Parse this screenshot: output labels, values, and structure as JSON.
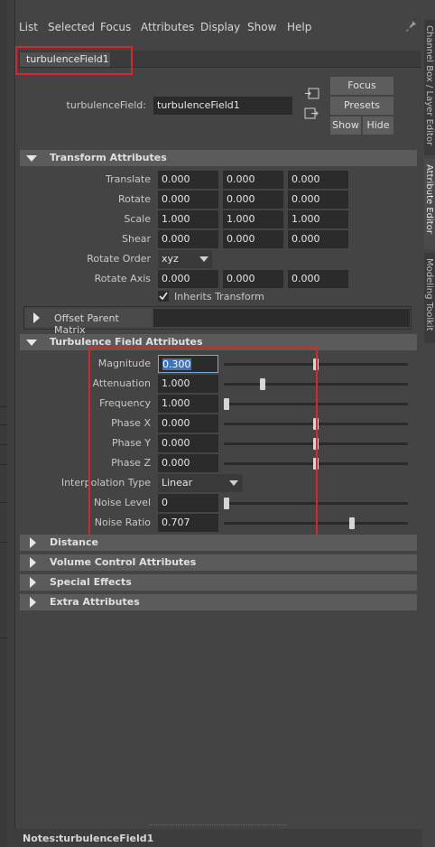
{
  "menubar": {
    "items": [
      "List",
      "Selected",
      "Focus",
      "Attributes",
      "Display",
      "Show",
      "Help"
    ]
  },
  "node_tab": "turbulenceField1",
  "header": {
    "node_type_label": "turbulenceField:",
    "node_name_value": "turbulenceField1",
    "focus_button": "Focus",
    "presets_button": "Presets",
    "show_button": "Show",
    "hide_button": "Hide"
  },
  "transform": {
    "title": "Transform Attributes",
    "translate": {
      "label": "Translate",
      "values": [
        "0.000",
        "0.000",
        "0.000"
      ]
    },
    "rotate": {
      "label": "Rotate",
      "values": [
        "0.000",
        "0.000",
        "0.000"
      ]
    },
    "scale": {
      "label": "Scale",
      "values": [
        "1.000",
        "1.000",
        "1.000"
      ]
    },
    "shear": {
      "label": "Shear",
      "values": [
        "0.000",
        "0.000",
        "0.000"
      ]
    },
    "rotate_order": {
      "label": "Rotate Order",
      "value": "xyz"
    },
    "rotate_axis": {
      "label": "Rotate Axis",
      "values": [
        "0.000",
        "0.000",
        "0.000"
      ]
    },
    "inherits_label": "Inherits Transform",
    "inherits_checked": true,
    "offset_parent": "Offset Parent Matrix"
  },
  "turbulence": {
    "title": "Turbulence Field Attributes",
    "rows": [
      {
        "label": "Magnitude",
        "value": "0.300",
        "slider": 0.5
      },
      {
        "label": "Attenuation",
        "value": "1.000",
        "slider": 0.2
      },
      {
        "label": "Frequency",
        "value": "1.000",
        "slider": 0.0
      },
      {
        "label": "Phase X",
        "value": "0.000",
        "slider": 0.5
      },
      {
        "label": "Phase Y",
        "value": "0.000",
        "slider": 0.5
      },
      {
        "label": "Phase Z",
        "value": "0.000",
        "slider": 0.5
      }
    ],
    "interpolation": {
      "label": "Interpolation Type",
      "value": "Linear"
    },
    "noise_level": {
      "label": "Noise Level",
      "value": "0",
      "slider": 0.0
    },
    "noise_ratio": {
      "label": "Noise Ratio",
      "value": "0.707",
      "slider": 0.7
    }
  },
  "collapsed_sections": [
    "Distance",
    "Volume Control Attributes",
    "Special Effects",
    "Extra Attributes"
  ],
  "side_tabs": [
    "Channel Box / Layer Editor",
    "Attribute Editor",
    "Modeling Toolkit"
  ],
  "notes": {
    "label": "Notes:",
    "value": "turbulenceField1"
  },
  "colors": {
    "highlight": "#d6272f",
    "background": "#444444",
    "field": "#2b2b2b",
    "section_header": "#5b5b5b"
  }
}
